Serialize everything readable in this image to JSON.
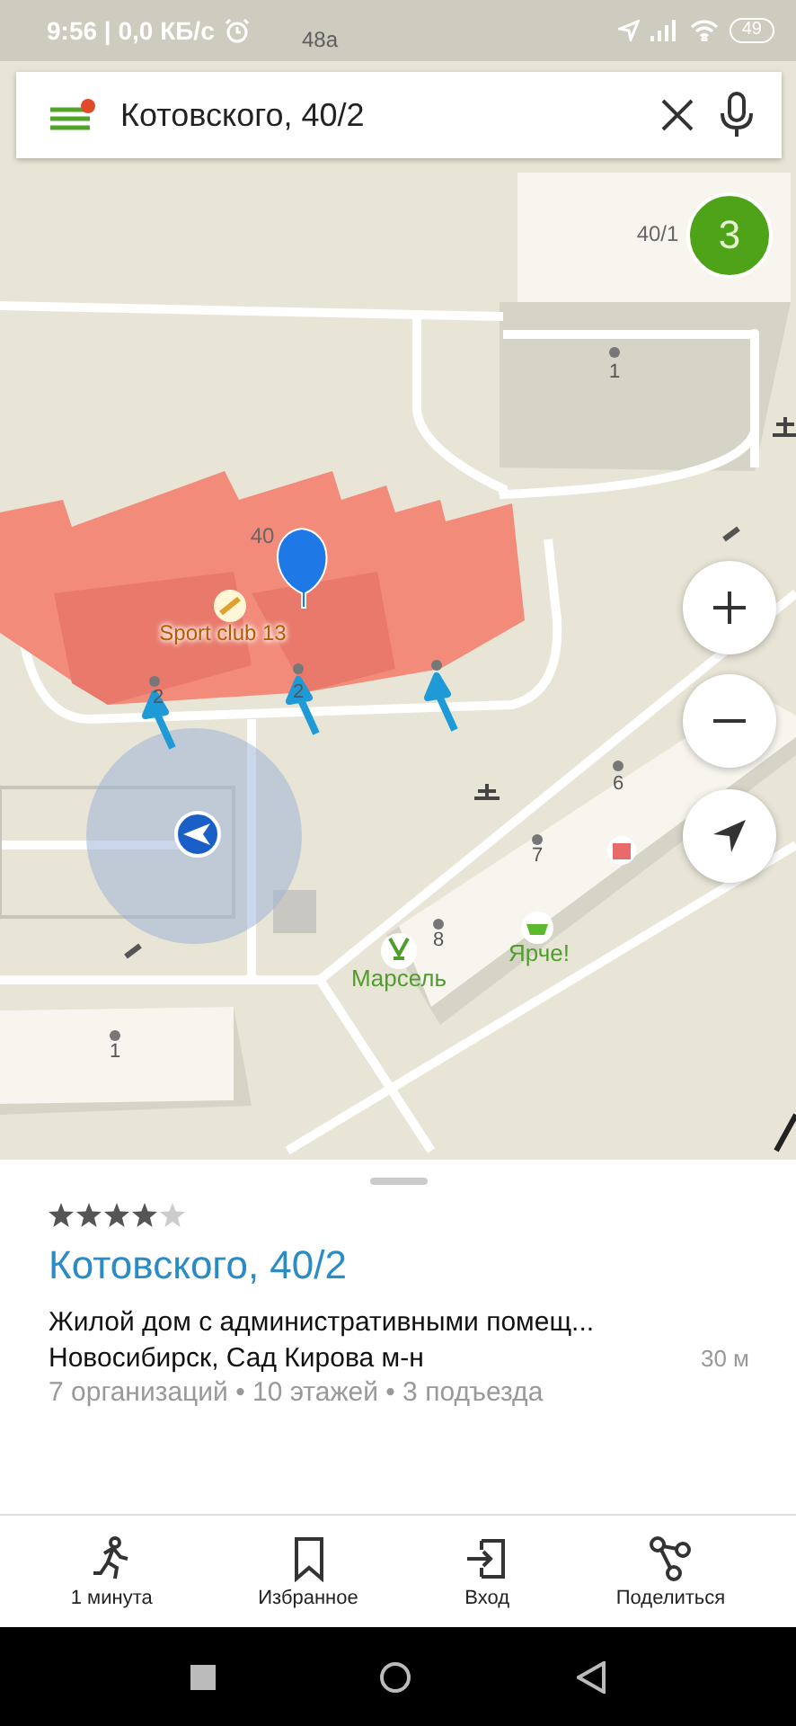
{
  "status_bar": {
    "time": "9:56 | 0,0 КБ/с",
    "battery": "49"
  },
  "search": {
    "value": "Котовского, 40/2",
    "menu_badge": true
  },
  "map": {
    "cluster": "3",
    "labels": [
      {
        "text": "48a",
        "kind": "house"
      },
      {
        "text": "40/1",
        "kind": "house"
      },
      {
        "text": "1",
        "kind": "entrance"
      },
      {
        "text": "40",
        "kind": "house"
      },
      {
        "text": "Sport club 13",
        "kind": "sport"
      },
      {
        "text": "2",
        "kind": "entrance"
      },
      {
        "text": "2",
        "kind": "entrance"
      },
      {
        "text": "6",
        "kind": "entrance"
      },
      {
        "text": "7",
        "kind": "entrance"
      },
      {
        "text": "8",
        "kind": "entrance"
      },
      {
        "text": "Марсель",
        "kind": "shop"
      },
      {
        "text": "Ярче!",
        "kind": "shop"
      },
      {
        "text": "1",
        "kind": "entrance"
      }
    ]
  },
  "sheet": {
    "stars": 4,
    "title": "Котовского, 40/2",
    "description": "Жилой дом с административными помещ...",
    "address": "Новосибирск, Сад Кирова м-н",
    "distance": "30 м",
    "meta": "7 организаций • 10 этажей • 3 подъезда"
  },
  "actions": [
    {
      "label": "1 минута",
      "kind": "walk"
    },
    {
      "label": "Избранное",
      "kind": "bookmark"
    },
    {
      "label": "Вход",
      "kind": "entrance"
    },
    {
      "label": "Поделиться",
      "kind": "share"
    }
  ]
}
